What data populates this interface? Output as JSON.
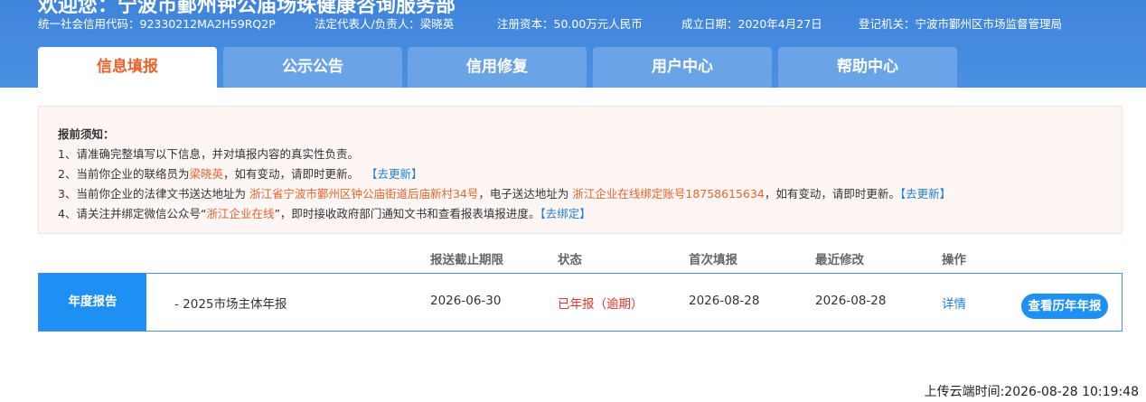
{
  "header": {
    "welcome": "欢迎您：宁波市鄞州钟公庙场珠健康咨询服务部",
    "credit_code": "统一社会信用代码：92330212MA2H59RQ2P",
    "legal_rep": "法定代表人/负责人：梁晓英",
    "capital": "注册资本：50.00万元人民币",
    "founded": "成立日期：2020年4月27日",
    "authority": "登记机关：宁波市鄞州区市场监督管理局"
  },
  "tabs": [
    {
      "label": "信息填报",
      "active": true
    },
    {
      "label": "公示公告",
      "active": false
    },
    {
      "label": "信用修复",
      "active": false
    },
    {
      "label": "用户中心",
      "active": false
    },
    {
      "label": "帮助中心",
      "active": false
    }
  ],
  "notice": {
    "title": "报前须知：",
    "line1": "1、请准确完整填写以下信息，并对填报内容的真实性负责。",
    "line2_pre": "2、当前你企业的联络员为",
    "line2_name": "梁晓英",
    "line2_post": "，如有变动，请即时更新。",
    "line2_link": "【去更新】",
    "line3_pre": "3、当前你企业的法律文书送达地址为",
    "line3_addr": "浙江省宁波市鄞州区钟公庙街道后庙新村34号",
    "line3_mid": "，电子送达地址为",
    "line3_eaddr": "浙江企业在线绑定账号18758615634",
    "line3_post": "，如有变动，请即时更新。",
    "line3_link": "【去更新】",
    "line4_pre": "4、请关注并绑定微信公众号“",
    "line4_name": "浙江企业在线",
    "line4_post": "”，即时接收政府部门通知文书和查看报表填报进度。",
    "line4_link": "【去绑定】"
  },
  "table": {
    "headers": [
      "报送截止期限",
      "状态",
      "首次填报",
      "最近修改",
      "操作"
    ],
    "row": {
      "label": "年度报告",
      "name": "- 2025市场主体年报",
      "deadline": "2026-06-30",
      "status": "已年报（逾期）",
      "first": "2026-08-28",
      "last": "2026-08-28",
      "detail": "详情",
      "history": "查看历年年报"
    }
  },
  "upload_time": "上传云端时间:2026-08-28 10:19:48",
  "colors": {
    "header_blue": "#4a90e2",
    "tab_inactive": "#6aa3e6",
    "accent_orange": "#e8642c",
    "link_blue": "#1f7fd8",
    "status_red": "#e0362c",
    "button_blue": "#1e90f3"
  }
}
